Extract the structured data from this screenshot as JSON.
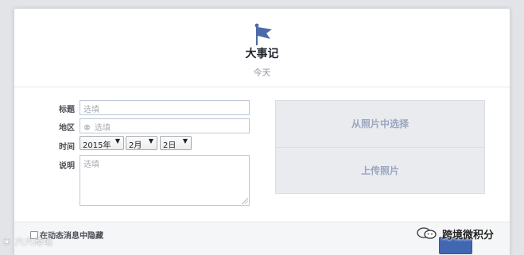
{
  "header": {
    "title": "大事记",
    "subtitle": "今天",
    "icon": "flag-icon"
  },
  "form": {
    "title": {
      "label": "标题",
      "placeholder": "选填"
    },
    "location": {
      "label": "地区",
      "placeholder": "选填",
      "icon": "location-pin-icon"
    },
    "time": {
      "label": "时间",
      "year": "2015年",
      "month": "2月",
      "day": "2日"
    },
    "description": {
      "label": "说明",
      "placeholder": "选填"
    }
  },
  "photos": {
    "choose_label": "从照片中选择",
    "upload_label": "上传照片"
  },
  "footer": {
    "hide_label": "在动态消息中隐藏",
    "hide_checked": false
  },
  "watermarks": {
    "left": "六六跨境",
    "right": "跨境微积分"
  },
  "colors": {
    "accent": "#4267b2",
    "panel": "#e9ebee",
    "panel_text": "#9ba6c0"
  }
}
